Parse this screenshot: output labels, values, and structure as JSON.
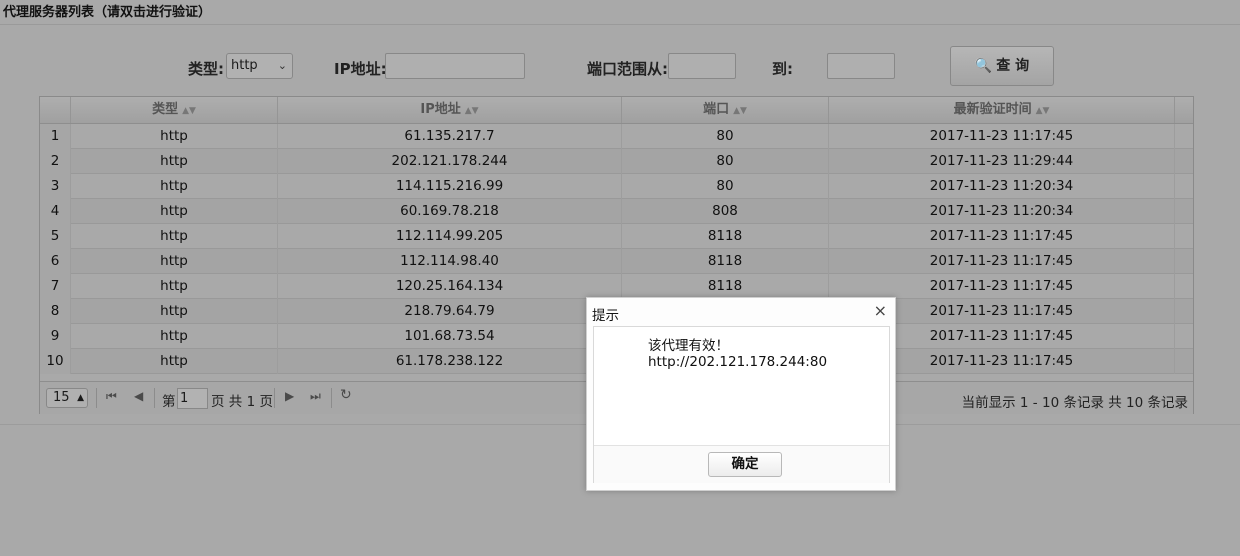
{
  "panel": {
    "title": "代理服务器列表（请双击进行验证）"
  },
  "search": {
    "type_label": "类型:",
    "type_value": "http",
    "ip_label": "IP地址:",
    "ip_value": "",
    "port_from_label": "端口范围从:",
    "port_from_value": "",
    "port_to_label": "到:",
    "port_to_value": "",
    "query_label": "查 询"
  },
  "table": {
    "columns": [
      "类型",
      "IP地址",
      "端口",
      "最新验证时间"
    ],
    "rows": [
      {
        "num": "1",
        "type": "http",
        "ip": "61.135.217.7",
        "port": "80",
        "time": "2017-11-23 11:17:45"
      },
      {
        "num": "2",
        "type": "http",
        "ip": "202.121.178.244",
        "port": "80",
        "time": "2017-11-23 11:29:44"
      },
      {
        "num": "3",
        "type": "http",
        "ip": "114.115.216.99",
        "port": "80",
        "time": "2017-11-23 11:20:34"
      },
      {
        "num": "4",
        "type": "http",
        "ip": "60.169.78.218",
        "port": "808",
        "time": "2017-11-23 11:20:34"
      },
      {
        "num": "5",
        "type": "http",
        "ip": "112.114.99.205",
        "port": "8118",
        "time": "2017-11-23 11:17:45"
      },
      {
        "num": "6",
        "type": "http",
        "ip": "112.114.98.40",
        "port": "8118",
        "time": "2017-11-23 11:17:45"
      },
      {
        "num": "7",
        "type": "http",
        "ip": "120.25.164.134",
        "port": "8118",
        "time": "2017-11-23 11:17:45"
      },
      {
        "num": "8",
        "type": "http",
        "ip": "218.79.64.79",
        "port": "",
        "time": "2017-11-23 11:17:45"
      },
      {
        "num": "9",
        "type": "http",
        "ip": "101.68.73.54",
        "port": "",
        "time": "2017-11-23 11:17:45"
      },
      {
        "num": "10",
        "type": "http",
        "ip": "61.178.238.122",
        "port": "",
        "time": "2017-11-23 11:17:45"
      }
    ]
  },
  "pager": {
    "page_size": "15",
    "page_prefix": "第",
    "page_value": "1",
    "page_suffix": "页 共 1 页",
    "info": "当前显示 1 - 10 条记录 共 10 条记录"
  },
  "dialog": {
    "title": "提示",
    "close_glyph": "×",
    "message_line1": "该代理有效！",
    "message_line2": "http://202.121.178.244:80",
    "ok_label": "确定"
  }
}
